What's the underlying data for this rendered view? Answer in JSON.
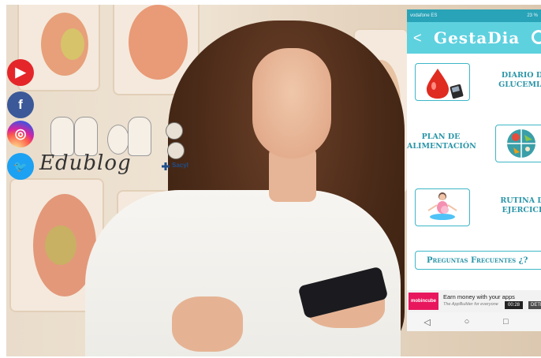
{
  "social": {
    "youtube_glyph": "▶",
    "facebook_glyph": "f",
    "instagram_glyph": "◎",
    "twitter_glyph": "🐦"
  },
  "logo": {
    "wordmark": "Edublog",
    "partner": "Sacyl"
  },
  "app": {
    "status_left": "vodafone ES",
    "status_right": "23 %",
    "back_glyph": "<",
    "title": "GestaDia",
    "tiles": [
      {
        "label_line1": "DIARIO D",
        "label_line2": "GLUCEMIA",
        "icon": "blood-drop-glucometer-icon"
      },
      {
        "label_line1": "PLAN DE",
        "label_line2": "ALIMENTACIÓN",
        "icon": "food-plate-icon"
      },
      {
        "label_line1": "RUTINA D",
        "label_line2": "EJERCICI",
        "icon": "pregnant-yoga-icon"
      }
    ],
    "faq_label": "Preguntas Frecuentes ¿?",
    "ad": {
      "brand": "mobincube",
      "headline": "Earn money with your apps",
      "subline": "The AppBuilder for everyone",
      "time": "00:28",
      "detect": "DETE"
    },
    "nav": {
      "back": "◁",
      "home": "○",
      "recent": "□"
    }
  },
  "colors": {
    "accent": "#5ed1df",
    "accent_dark": "#2a95a8",
    "youtube": "#e4262a",
    "facebook": "#3b5998",
    "twitter": "#1da1f2",
    "ad_brand": "#e8175d"
  }
}
